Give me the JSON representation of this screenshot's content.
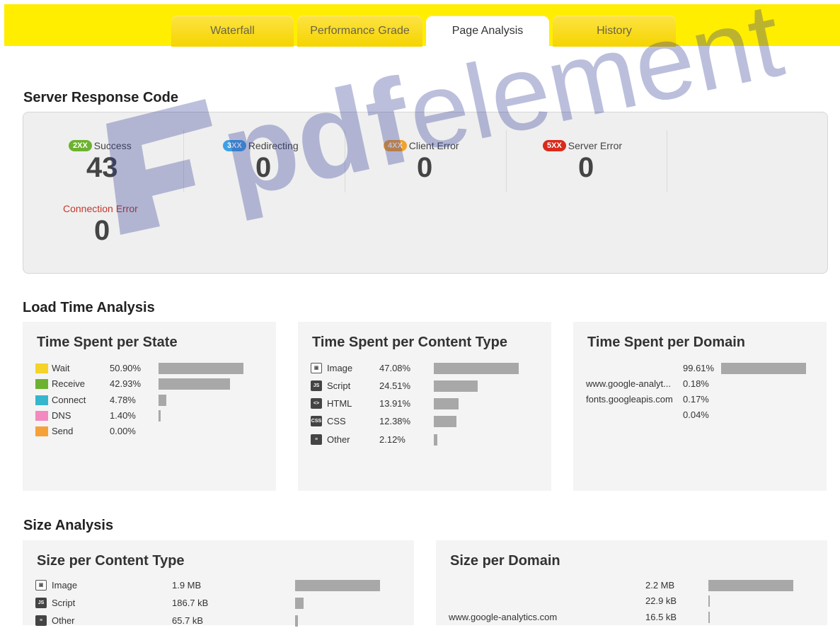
{
  "tabs": [
    {
      "label": "Waterfall",
      "active": false
    },
    {
      "label": "Performance Grade",
      "active": false
    },
    {
      "label": "Page Analysis",
      "active": true
    },
    {
      "label": "History",
      "active": false
    }
  ],
  "response_code": {
    "title": "Server Response Code",
    "items": [
      {
        "badge": "2XX",
        "label": "Success",
        "value": "43",
        "color": "#6cb230"
      },
      {
        "badge": "3XX",
        "label": "Redirecting",
        "value": "0",
        "color": "#3fa0e6"
      },
      {
        "badge": "4XX",
        "label": "Client Error",
        "value": "0",
        "color": "#f4a12c"
      },
      {
        "badge": "5XX",
        "label": "Server Error",
        "value": "0",
        "color": "#d92a1c"
      }
    ],
    "connection_error": {
      "label": "Connection Error",
      "value": "0",
      "color": "#c0392b"
    }
  },
  "load_time": {
    "title": "Load Time Analysis",
    "per_state": {
      "title": "Time Spent per State",
      "rows": [
        {
          "label": "Wait",
          "pct": "50.90%",
          "value": 50.9,
          "color": "#f5d327"
        },
        {
          "label": "Receive",
          "pct": "42.93%",
          "value": 42.93,
          "color": "#6cb230"
        },
        {
          "label": "Connect",
          "pct": "4.78%",
          "value": 4.78,
          "color": "#35b6cc"
        },
        {
          "label": "DNS",
          "pct": "1.40%",
          "value": 1.4,
          "color": "#f28ac0"
        },
        {
          "label": "Send",
          "pct": "0.00%",
          "value": 0.0,
          "color": "#f5a138"
        }
      ]
    },
    "per_content": {
      "title": "Time Spent per Content Type",
      "rows": [
        {
          "label": "Image",
          "pct": "47.08%",
          "value": 47.08,
          "icon": "image-icon"
        },
        {
          "label": "Script",
          "pct": "24.51%",
          "value": 24.51,
          "icon": "script-icon"
        },
        {
          "label": "HTML",
          "pct": "13.91%",
          "value": 13.91,
          "icon": "html-icon"
        },
        {
          "label": "CSS",
          "pct": "12.38%",
          "value": 12.38,
          "icon": "css-icon"
        },
        {
          "label": "Other",
          "pct": "2.12%",
          "value": 2.12,
          "icon": "other-icon"
        }
      ]
    },
    "per_domain": {
      "title": "Time Spent per Domain",
      "rows": [
        {
          "label": "",
          "pct": "99.61%",
          "value": 99.61
        },
        {
          "label": "www.google-analyt...",
          "pct": "0.18%",
          "value": 0.18
        },
        {
          "label": "fonts.googleapis.com",
          "pct": "0.17%",
          "value": 0.17
        },
        {
          "label": "",
          "pct": "0.04%",
          "value": 0.04
        }
      ]
    }
  },
  "size": {
    "title": "Size Analysis",
    "per_content": {
      "title": "Size per Content Type",
      "rows": [
        {
          "label": "Image",
          "size": "1.9 MB",
          "value": 1900,
          "icon": "image-icon"
        },
        {
          "label": "Script",
          "size": "186.7 kB",
          "value": 186.7,
          "icon": "script-icon"
        },
        {
          "label": "Other",
          "size": "65.7 kB",
          "value": 65.7,
          "icon": "other-icon"
        }
      ]
    },
    "per_domain": {
      "title": "Size per Domain",
      "rows": [
        {
          "label": "",
          "size": "2.2 MB",
          "value": 2200
        },
        {
          "label": "",
          "size": "22.9 kB",
          "value": 22.9
        },
        {
          "label": "www.google-analytics.com",
          "size": "16.5 kB",
          "value": 16.5
        }
      ]
    }
  },
  "watermark": {
    "text_a": "pdf",
    "text_b": "element",
    "color": "#2f3b96"
  }
}
